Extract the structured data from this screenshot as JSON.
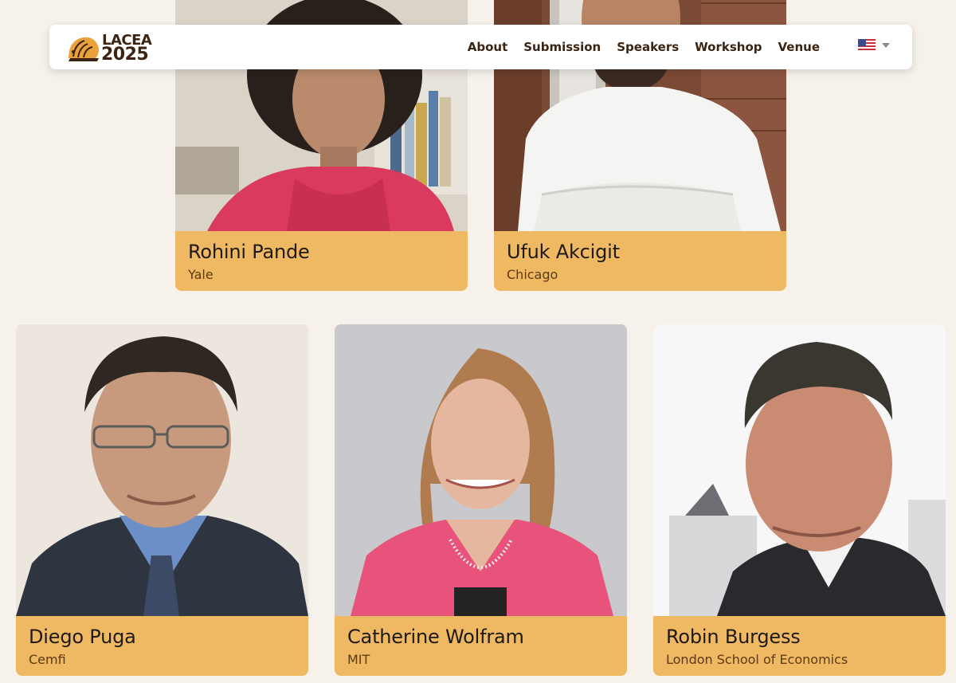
{
  "header": {
    "logo_line1": "LACEA",
    "logo_line2": "2025",
    "nav": [
      "About",
      "Submission",
      "Speakers",
      "Workshop",
      "Venue"
    ],
    "language_icon": "us-flag-icon"
  },
  "speakers": [
    {
      "name": "Rohini Pande",
      "affiliation": "Yale"
    },
    {
      "name": "Ufuk Akcigit",
      "affiliation": "Chicago"
    },
    {
      "name": "Diego Puga",
      "affiliation": "Cemfi"
    },
    {
      "name": "Catherine Wolfram",
      "affiliation": "MIT"
    },
    {
      "name": "Robin Burgess",
      "affiliation": "London School of Economics"
    }
  ],
  "colors": {
    "page_bg": "#f6f1ea",
    "card_caption": "#efb964",
    "brand_text": "#3b2413"
  }
}
